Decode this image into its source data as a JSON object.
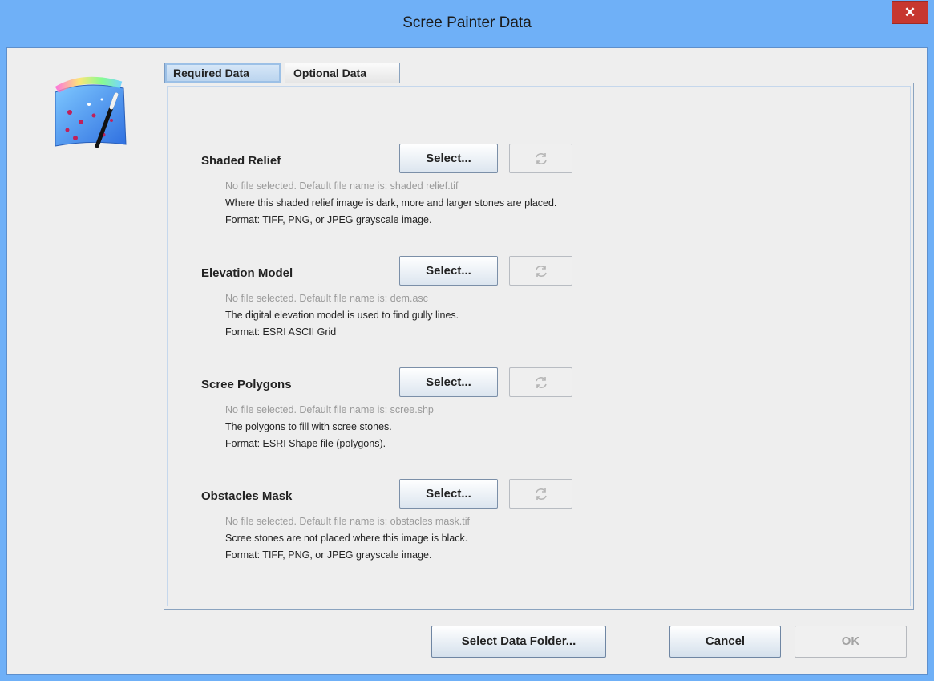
{
  "window": {
    "title": "Scree Painter Data",
    "close_symbol": "✕"
  },
  "tabs": [
    {
      "label": "Required Data",
      "active": true
    },
    {
      "label": "Optional Data",
      "active": false
    }
  ],
  "sections": [
    {
      "label": "Shaded Relief",
      "select_label": "Select...",
      "default_text": "No file selected. Default file name is: shaded relief.tif",
      "description": "Where this shaded relief image is dark, more and larger stones are placed.",
      "format": "Format: TIFF, PNG, or JPEG grayscale image."
    },
    {
      "label": "Elevation Model",
      "select_label": "Select...",
      "default_text": "No file selected. Default file name is: dem.asc",
      "description": "The digital elevation model is used to find gully lines.",
      "format": "Format: ESRI ASCII Grid"
    },
    {
      "label": "Scree Polygons",
      "select_label": "Select...",
      "default_text": "No file selected. Default file name is: scree.shp",
      "description": "The polygons to fill with scree stones.",
      "format": "Format: ESRI Shape file (polygons)."
    },
    {
      "label": "Obstacles Mask",
      "select_label": "Select...",
      "default_text": "No file selected. Default file name is: obstacles mask.tif",
      "description": "Scree stones are not placed where this image is black.",
      "format": "Format: TIFF, PNG, or JPEG grayscale image."
    }
  ],
  "footer": {
    "select_folder_label": "Select Data Folder...",
    "cancel_label": "Cancel",
    "ok_label": "OK"
  },
  "icons": {
    "app": "scree-painter-magic-wand-icon",
    "reload": "reload-icon",
    "close": "close-icon"
  },
  "colors": {
    "titlebar": "#6fb0f7",
    "close_button": "#c7372f",
    "dialog_bg": "#eeeeee"
  }
}
